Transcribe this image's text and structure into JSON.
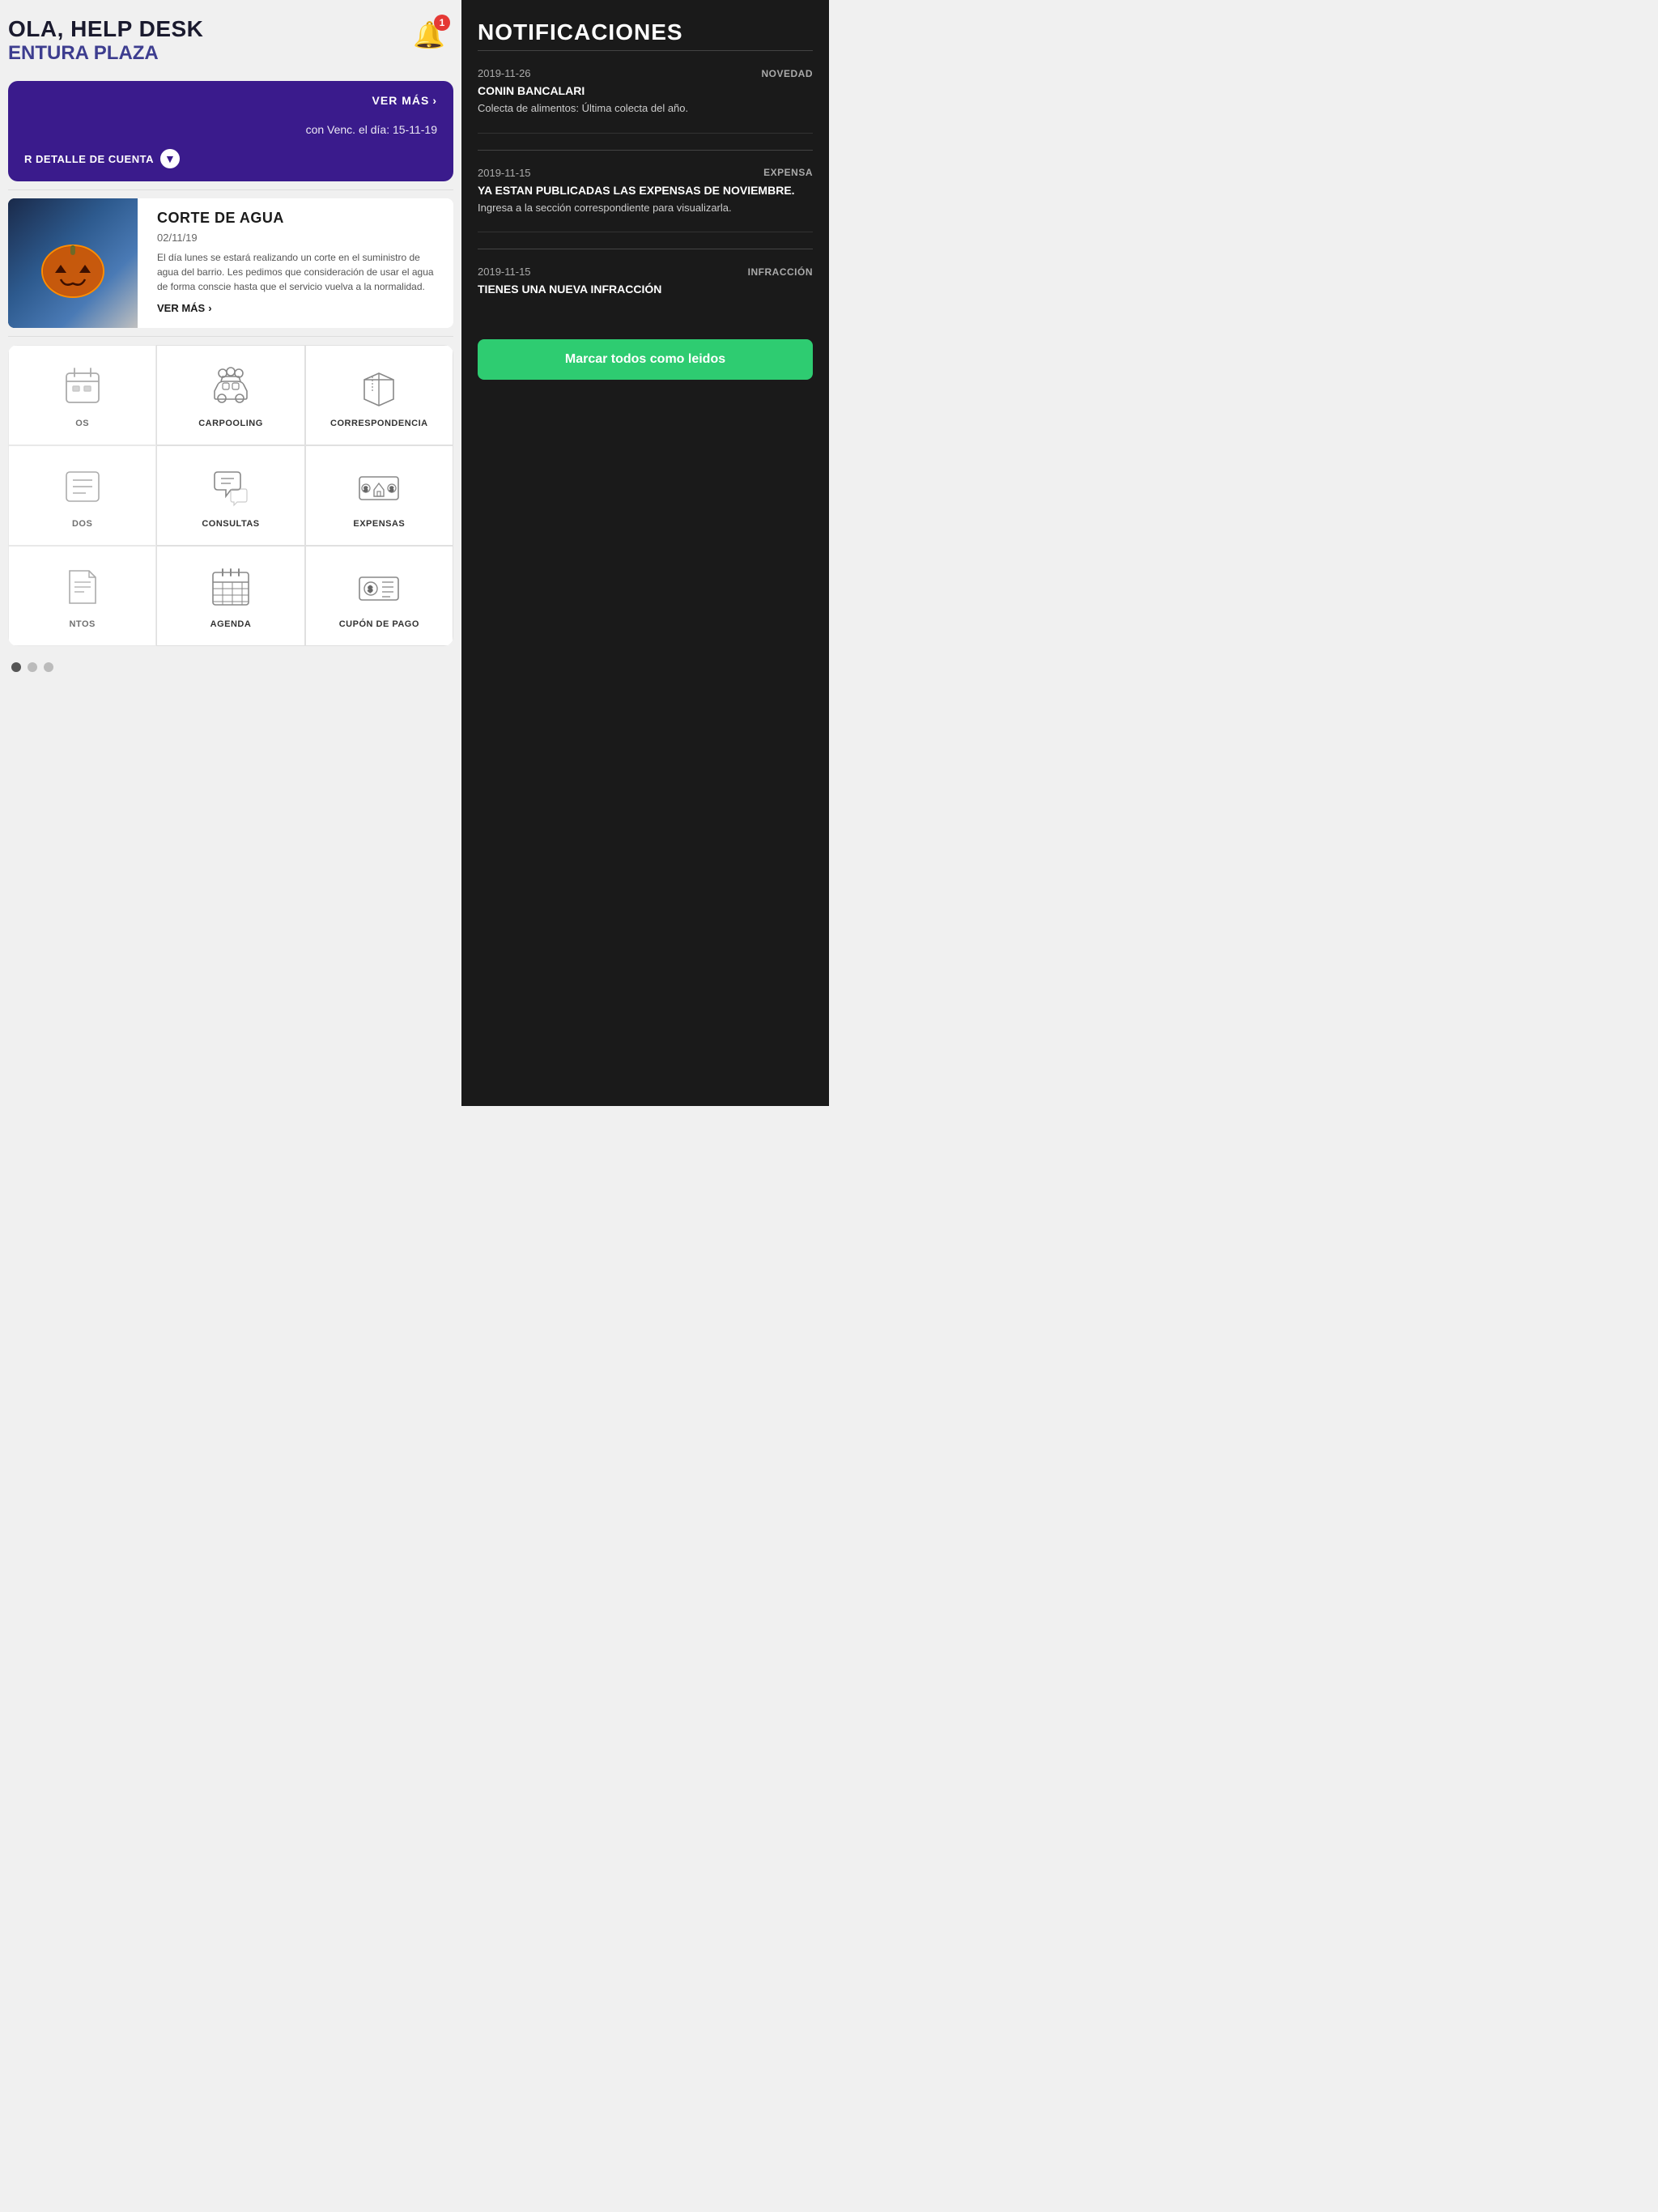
{
  "header": {
    "greeting": "OLA, HELP DESK",
    "location": "ENTURA PLAZA",
    "bell_count": 1
  },
  "purple_card": {
    "ver_mas": "VER MÁS",
    "vencimiento": "con Venc. el día: 15-11-19",
    "detalle_label": "R DETALLE DE CUENTA"
  },
  "news": {
    "title": "CORTE DE AGUA",
    "date": "02/11/19",
    "body": "El día lunes se estará realizando un corte en el suministro de agua del barrio. Les pedimos que consideración de usar el agua de forma conscie hasta que el servicio vuelva a la normalidad.",
    "ver_mas": "VER MÁS"
  },
  "services": [
    {
      "id": "eventos",
      "label": "OS",
      "icon": "events"
    },
    {
      "id": "carpooling",
      "label": "CARPOOLING",
      "icon": "carpooling"
    },
    {
      "id": "correspondencia",
      "label": "CORRESPONDENCIA",
      "icon": "package"
    },
    {
      "id": "col1",
      "label": "DOS",
      "icon": "list"
    },
    {
      "id": "consultas",
      "label": "CONSULTAS",
      "icon": "chat"
    },
    {
      "id": "expensas",
      "label": "EXPENSAS",
      "icon": "money-house"
    },
    {
      "id": "col2",
      "label": "NTOS",
      "icon": "doc"
    },
    {
      "id": "agenda",
      "label": "AGENDA",
      "icon": "calendar"
    },
    {
      "id": "cupon",
      "label": "CUPÓN DE PAGO",
      "icon": "coupon"
    }
  ],
  "pagination": {
    "dots": [
      true,
      false,
      false
    ]
  },
  "notifications": {
    "title": "NOTIFICACIONES",
    "items": [
      {
        "date": "2019-11-26",
        "type": "NOVEDAD",
        "sender": "CONIN BANCALARI",
        "body": "Colecta de alimentos: Última colecta del año."
      },
      {
        "date": "2019-11-15",
        "type": "EXPENSA",
        "sender": "YA ESTAN PUBLICADAS LAS EXPENSAS DE NOVIEMBRE.",
        "body": "Ingresa a la sección correspondiente para visualizarla."
      },
      {
        "date": "2019-11-15",
        "type": "INFRACCIÓN",
        "sender": "TIENES UNA NUEVA INFRACCIÓN",
        "body": ""
      }
    ],
    "mark_all_btn": "Marcar todos como leidos"
  }
}
